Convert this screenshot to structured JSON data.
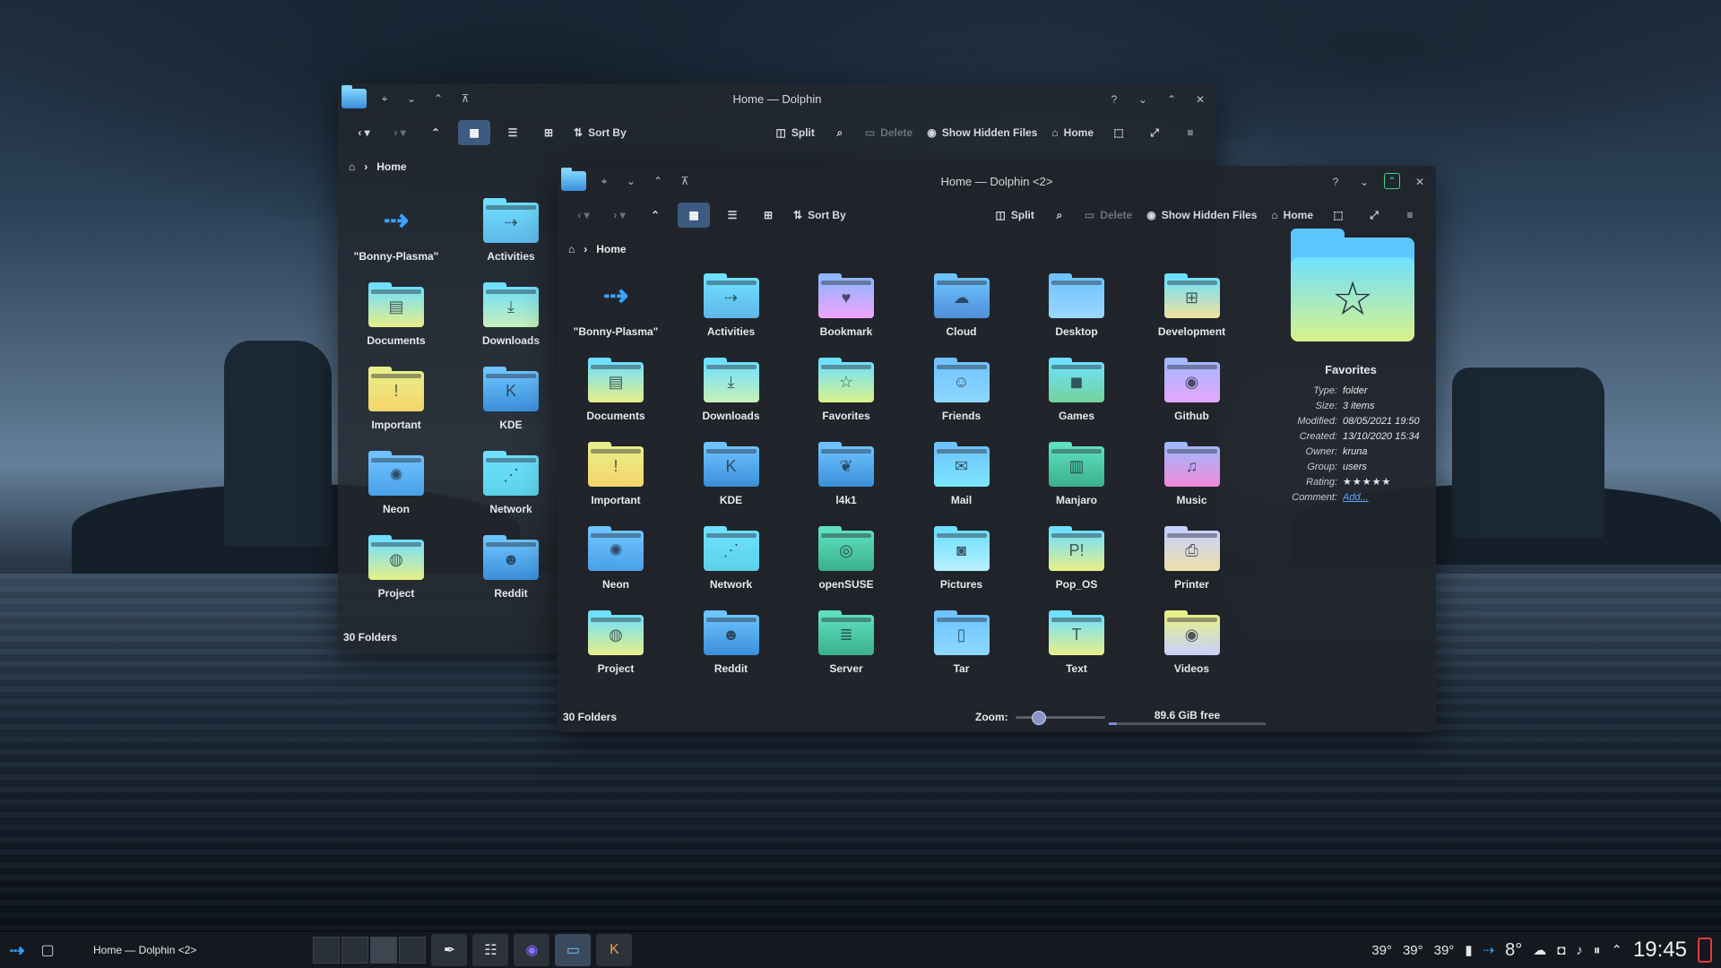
{
  "back_window": {
    "title": "Home — Dolphin",
    "toolbar": {
      "sort_by": "Sort By",
      "split": "Split",
      "delete": "Delete",
      "show_hidden": "Show Hidden Files",
      "home": "Home"
    },
    "breadcrumb": "Home",
    "items": [
      {
        "label": "\"Bonny-Plasma\"",
        "kind": "plasma"
      },
      {
        "label": "Activities",
        "glyph": "⇢",
        "top": "#6ee0ff",
        "bottom": "#5fb7e8"
      },
      {
        "label": "Documents",
        "glyph": "▤",
        "top": "#6ee0ff",
        "bottom": "#e8ef88"
      },
      {
        "label": "Downloads",
        "glyph": "⤓",
        "top": "#6ee0ff",
        "bottom": "#c8f0b8"
      },
      {
        "label": "Important",
        "glyph": "!",
        "top": "#e8ef88",
        "bottom": "#f5d46a"
      },
      {
        "label": "KDE",
        "glyph": "K",
        "top": "#6ec3ff",
        "bottom": "#3a8fd9"
      },
      {
        "label": "Neon",
        "glyph": "✺",
        "top": "#6ec3ff",
        "bottom": "#4aa0e8"
      },
      {
        "label": "Network",
        "glyph": "⋰",
        "top": "#6ee0ff",
        "bottom": "#5cd2e8"
      },
      {
        "label": "Project",
        "glyph": "◍",
        "top": "#6ee0ff",
        "bottom": "#e8ef88"
      },
      {
        "label": "Reddit",
        "glyph": "☻",
        "top": "#6ec3ff",
        "bottom": "#3a8fd9"
      }
    ],
    "status": "30 Folders"
  },
  "front_window": {
    "title": "Home — Dolphin <2>",
    "toolbar": {
      "sort_by": "Sort By",
      "split": "Split",
      "delete": "Delete",
      "show_hidden": "Show Hidden Files",
      "home": "Home"
    },
    "breadcrumb": "Home",
    "items": [
      {
        "label": "\"Bonny-Plasma\"",
        "kind": "plasma"
      },
      {
        "label": "Activities",
        "glyph": "⇢",
        "top": "#6ee0ff",
        "bottom": "#5fb7e8"
      },
      {
        "label": "Bookmark",
        "glyph": "♥",
        "top": "#8fb6ff",
        "bottom": "#f0a4ff"
      },
      {
        "label": "Cloud",
        "glyph": "☁",
        "top": "#6ec3ff",
        "bottom": "#4f8fd9"
      },
      {
        "label": "Desktop",
        "glyph": "",
        "top": "#6ec3ff",
        "bottom": "#9ad8ff"
      },
      {
        "label": "Development",
        "glyph": "⊞",
        "top": "#6ee0ff",
        "bottom": "#f3e29a"
      },
      {
        "label": "Documents",
        "glyph": "▤",
        "top": "#6ee0ff",
        "bottom": "#e8ef88"
      },
      {
        "label": "Downloads",
        "glyph": "⤓",
        "top": "#6ee0ff",
        "bottom": "#c8f0b8"
      },
      {
        "label": "Favorites",
        "glyph": "☆",
        "top": "#6ee0ff",
        "bottom": "#d9f28a"
      },
      {
        "label": "Friends",
        "glyph": "☺",
        "top": "#6ec3ff",
        "bottom": "#8fd8ff"
      },
      {
        "label": "Games",
        "glyph": "◼",
        "top": "#6ee0ff",
        "bottom": "#74d39a"
      },
      {
        "label": "Github",
        "glyph": "◉",
        "top": "#a2b8ff",
        "bottom": "#e6a8ff"
      },
      {
        "label": "Important",
        "glyph": "!",
        "top": "#e8ef88",
        "bottom": "#f5d46a"
      },
      {
        "label": "KDE",
        "glyph": "K",
        "top": "#6ec3ff",
        "bottom": "#3a8fd9"
      },
      {
        "label": "l4k1",
        "glyph": "❦",
        "top": "#6ec3ff",
        "bottom": "#3a8fd9"
      },
      {
        "label": "Mail",
        "glyph": "✉",
        "top": "#6ec3ff",
        "bottom": "#7ce8ff"
      },
      {
        "label": "Manjaro",
        "glyph": "▥",
        "top": "#5fe0c0",
        "bottom": "#3ab08a"
      },
      {
        "label": "Music",
        "glyph": "♫",
        "top": "#a2b8ff",
        "bottom": "#f08ad8"
      },
      {
        "label": "Neon",
        "glyph": "✺",
        "top": "#6ec3ff",
        "bottom": "#4aa0e8"
      },
      {
        "label": "Network",
        "glyph": "⋰",
        "top": "#6ee0ff",
        "bottom": "#5cd2e8"
      },
      {
        "label": "openSUSE",
        "glyph": "◎",
        "top": "#5fe0c0",
        "bottom": "#3ab08a"
      },
      {
        "label": "Pictures",
        "glyph": "◙",
        "top": "#6ee0ff",
        "bottom": "#b8f0ff"
      },
      {
        "label": "Pop_OS",
        "glyph": "P!",
        "top": "#6ee0ff",
        "bottom": "#e8ef88"
      },
      {
        "label": "Printer",
        "glyph": "⎙",
        "top": "#c8d0ff",
        "bottom": "#f0e0a8"
      },
      {
        "label": "Project",
        "glyph": "◍",
        "top": "#6ee0ff",
        "bottom": "#e8ef88"
      },
      {
        "label": "Reddit",
        "glyph": "☻",
        "top": "#6ec3ff",
        "bottom": "#3a8fd9"
      },
      {
        "label": "Server",
        "glyph": "≣",
        "top": "#5fe0c0",
        "bottom": "#3ab08a"
      },
      {
        "label": "Tar",
        "glyph": "▯",
        "top": "#6ec3ff",
        "bottom": "#8fd8ff"
      },
      {
        "label": "Text",
        "glyph": "T",
        "top": "#6ee0ff",
        "bottom": "#e8ef88"
      },
      {
        "label": "Videos",
        "glyph": "◉",
        "top": "#e8ef88",
        "bottom": "#c8d0ff"
      }
    ],
    "status": "30 Folders",
    "zoom_label": "Zoom:",
    "zoom_level": 0.25,
    "disk_free": "89.6 GiB free",
    "disk_used_fraction": 0.05,
    "info_panel": {
      "name": "Favorites",
      "rows": [
        {
          "key": "Type:",
          "value": "folder"
        },
        {
          "key": "Size:",
          "value": "3 items"
        },
        {
          "key": "Modified:",
          "value": "08/05/2021 19:50"
        },
        {
          "key": "Created:",
          "value": "13/10/2020 15:34"
        },
        {
          "key": "Owner:",
          "value": "kruna"
        },
        {
          "key": "Group:",
          "value": "users"
        }
      ],
      "rating_key": "Rating:",
      "rating": 5,
      "comment_key": "Comment:",
      "comment_link": "Add..."
    }
  },
  "taskbar": {
    "task_label": "Home — Dolphin <2>",
    "temps": [
      "39°",
      "39°",
      "39°"
    ],
    "weather_temp": "8°",
    "clock": "19:45"
  },
  "colors": {
    "accent": "#3d5a80",
    "active_max": "#39d98a",
    "link": "#5aa9ff",
    "star": "#4f8ef7"
  }
}
